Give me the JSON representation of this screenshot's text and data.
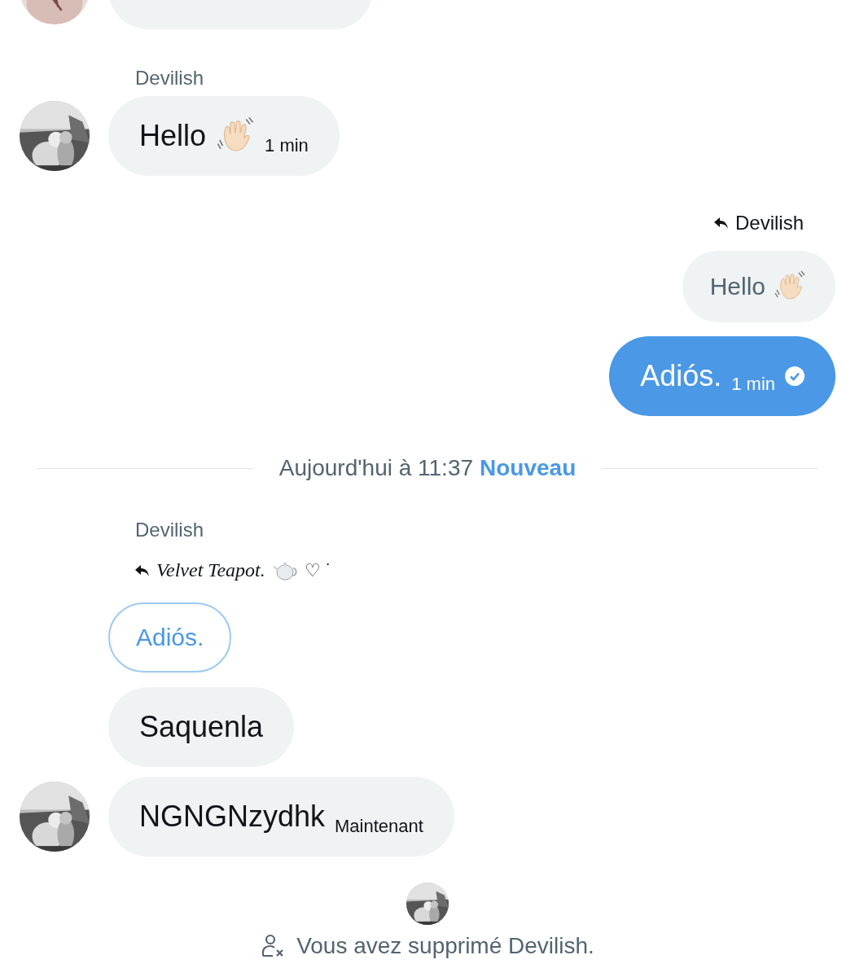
{
  "messages": [
    {
      "kind": "partial",
      "avatar": true
    },
    {
      "kind": "sender",
      "name": "Devilish"
    },
    {
      "kind": "incoming",
      "text": "Hello",
      "wave": true,
      "time": "1 min",
      "avatar": true
    },
    {
      "kind": "reply_out",
      "text": "Devilish"
    },
    {
      "kind": "quoted_out",
      "text": "Hello",
      "wave": true
    },
    {
      "kind": "outgoing",
      "text": "Adiós.",
      "time": "1 min",
      "read": true
    },
    {
      "kind": "divider",
      "text": "Aujourd'hui à 11:37",
      "badge": "Nouveau"
    },
    {
      "kind": "sender",
      "name": "Devilish"
    },
    {
      "kind": "reply_in",
      "text": "Velvet Teapot.",
      "teapot": true,
      "suffix": "♡ ˙"
    },
    {
      "kind": "quoted_in",
      "text": "Adiós."
    },
    {
      "kind": "incoming",
      "text": "Saquenla",
      "avatar": false
    },
    {
      "kind": "incoming",
      "text": "NGNGNzydhk",
      "time": "Maintenant",
      "avatar": true
    },
    {
      "kind": "notice",
      "text": "Vous avez supprimé Devilish."
    }
  ]
}
